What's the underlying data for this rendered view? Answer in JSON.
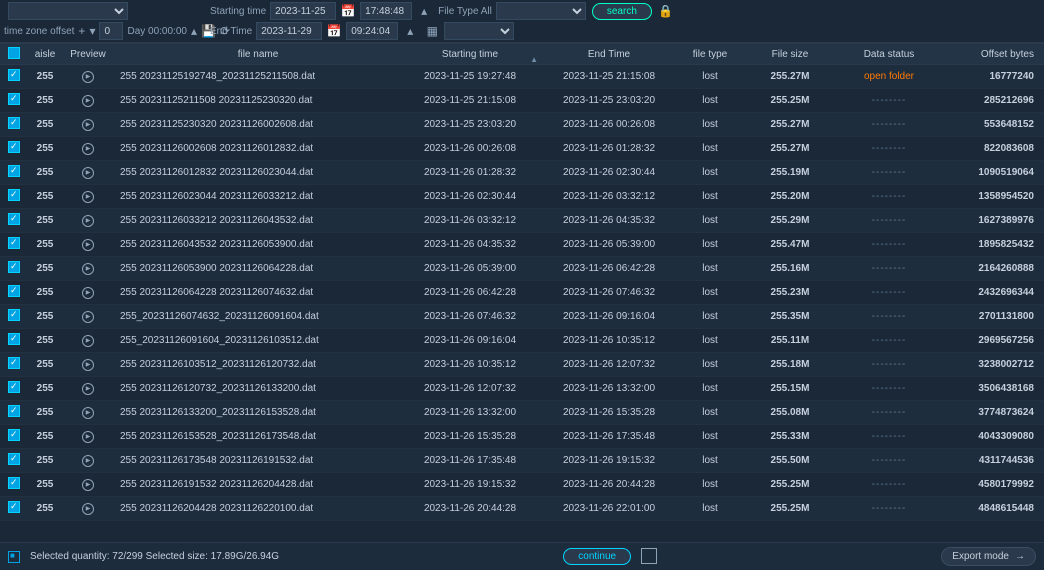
{
  "filters": {
    "time_zone_offset_label": "time zone offset",
    "starting_time_label": "Starting time",
    "end_time_label": "End Time",
    "start_date": "2023-11-25",
    "start_time": "17:48:48",
    "end_date": "2023-11-29",
    "end_time": "09:24:04",
    "file_type_label": "File Type All",
    "day_value": "0",
    "day_time": "Day 00:00:00",
    "search_label": "search"
  },
  "headers": {
    "aisle": "aisle",
    "preview": "Preview",
    "file_name": "file name",
    "starting_time": "Starting time",
    "end_time": "End Time",
    "file_type": "file type",
    "file_size": "File size",
    "data_status": "Data status",
    "offset_bytes": "Offset bytes"
  },
  "rows": [
    {
      "aisle": "255",
      "name": "255 20231125192748_20231125211508.dat",
      "start": "2023-11-25 19:27:48",
      "end": "2023-11-25 21:15:08",
      "type": "lost",
      "size": "255.27M",
      "status": "open folder",
      "status_kind": "open",
      "offset": "16777240"
    },
    {
      "aisle": "255",
      "name": "255 20231125211508 20231125230320.dat",
      "start": "2023-11-25 21:15:08",
      "end": "2023-11-25 23:03:20",
      "type": "lost",
      "size": "255.25M",
      "status": "--------",
      "status_kind": "dash",
      "offset": "285212696"
    },
    {
      "aisle": "255",
      "name": "255 20231125230320 20231126002608.dat",
      "start": "2023-11-25 23:03:20",
      "end": "2023-11-26 00:26:08",
      "type": "lost",
      "size": "255.27M",
      "status": "--------",
      "status_kind": "dash",
      "offset": "553648152"
    },
    {
      "aisle": "255",
      "name": "255 20231126002608 20231126012832.dat",
      "start": "2023-11-26 00:26:08",
      "end": "2023-11-26 01:28:32",
      "type": "lost",
      "size": "255.27M",
      "status": "--------",
      "status_kind": "dash",
      "offset": "822083608"
    },
    {
      "aisle": "255",
      "name": "255 20231126012832 20231126023044.dat",
      "start": "2023-11-26 01:28:32",
      "end": "2023-11-26 02:30:44",
      "type": "lost",
      "size": "255.19M",
      "status": "--------",
      "status_kind": "dash",
      "offset": "1090519064"
    },
    {
      "aisle": "255",
      "name": "255 20231126023044 20231126033212.dat",
      "start": "2023-11-26 02:30:44",
      "end": "2023-11-26 03:32:12",
      "type": "lost",
      "size": "255.20M",
      "status": "--------",
      "status_kind": "dash",
      "offset": "1358954520"
    },
    {
      "aisle": "255",
      "name": "255 20231126033212 20231126043532.dat",
      "start": "2023-11-26 03:32:12",
      "end": "2023-11-26 04:35:32",
      "type": "lost",
      "size": "255.29M",
      "status": "--------",
      "status_kind": "dash",
      "offset": "1627389976"
    },
    {
      "aisle": "255",
      "name": "255 20231126043532 20231126053900.dat",
      "start": "2023-11-26 04:35:32",
      "end": "2023-11-26 05:39:00",
      "type": "lost",
      "size": "255.47M",
      "status": "--------",
      "status_kind": "dash",
      "offset": "1895825432"
    },
    {
      "aisle": "255",
      "name": "255 20231126053900 20231126064228.dat",
      "start": "2023-11-26 05:39:00",
      "end": "2023-11-26 06:42:28",
      "type": "lost",
      "size": "255.16M",
      "status": "--------",
      "status_kind": "dash",
      "offset": "2164260888"
    },
    {
      "aisle": "255",
      "name": "255 20231126064228 20231126074632.dat",
      "start": "2023-11-26 06:42:28",
      "end": "2023-11-26 07:46:32",
      "type": "lost",
      "size": "255.23M",
      "status": "--------",
      "status_kind": "dash",
      "offset": "2432696344"
    },
    {
      "aisle": "255",
      "name": "255_20231126074632_20231126091604.dat",
      "start": "2023-11-26 07:46:32",
      "end": "2023-11-26 09:16:04",
      "type": "lost",
      "size": "255.35M",
      "status": "--------",
      "status_kind": "dash",
      "offset": "2701131800"
    },
    {
      "aisle": "255",
      "name": "255_20231126091604_20231126103512.dat",
      "start": "2023-11-26 09:16:04",
      "end": "2023-11-26 10:35:12",
      "type": "lost",
      "size": "255.11M",
      "status": "--------",
      "status_kind": "dash",
      "offset": "2969567256"
    },
    {
      "aisle": "255",
      "name": "255 20231126103512_20231126120732.dat",
      "start": "2023-11-26 10:35:12",
      "end": "2023-11-26 12:07:32",
      "type": "lost",
      "size": "255.18M",
      "status": "--------",
      "status_kind": "dash",
      "offset": "3238002712"
    },
    {
      "aisle": "255",
      "name": "255 20231126120732_20231126133200.dat",
      "start": "2023-11-26 12:07:32",
      "end": "2023-11-26 13:32:00",
      "type": "lost",
      "size": "255.15M",
      "status": "--------",
      "status_kind": "dash",
      "offset": "3506438168"
    },
    {
      "aisle": "255",
      "name": "255 20231126133200_20231126153528.dat",
      "start": "2023-11-26 13:32:00",
      "end": "2023-11-26 15:35:28",
      "type": "lost",
      "size": "255.08M",
      "status": "--------",
      "status_kind": "dash",
      "offset": "3774873624"
    },
    {
      "aisle": "255",
      "name": "255 20231126153528_20231126173548.dat",
      "start": "2023-11-26 15:35:28",
      "end": "2023-11-26 17:35:48",
      "type": "lost",
      "size": "255.33M",
      "status": "--------",
      "status_kind": "dash",
      "offset": "4043309080"
    },
    {
      "aisle": "255",
      "name": "255 20231126173548 20231126191532.dat",
      "start": "2023-11-26 17:35:48",
      "end": "2023-11-26 19:15:32",
      "type": "lost",
      "size": "255.50M",
      "status": "--------",
      "status_kind": "dash",
      "offset": "4311744536"
    },
    {
      "aisle": "255",
      "name": "255 20231126191532 20231126204428.dat",
      "start": "2023-11-26 19:15:32",
      "end": "2023-11-26 20:44:28",
      "type": "lost",
      "size": "255.25M",
      "status": "--------",
      "status_kind": "dash",
      "offset": "4580179992"
    },
    {
      "aisle": "255",
      "name": "255 20231126204428 20231126220100.dat",
      "start": "2023-11-26 20:44:28",
      "end": "2023-11-26 22:01:00",
      "type": "lost",
      "size": "255.25M",
      "status": "--------",
      "status_kind": "dash",
      "offset": "4848615448"
    }
  ],
  "bottom": {
    "selected_text": "Selected quantity: 72/299 Selected size: 17.89G/26.94G",
    "continue_label": "continue",
    "export_label": "Export mode"
  }
}
